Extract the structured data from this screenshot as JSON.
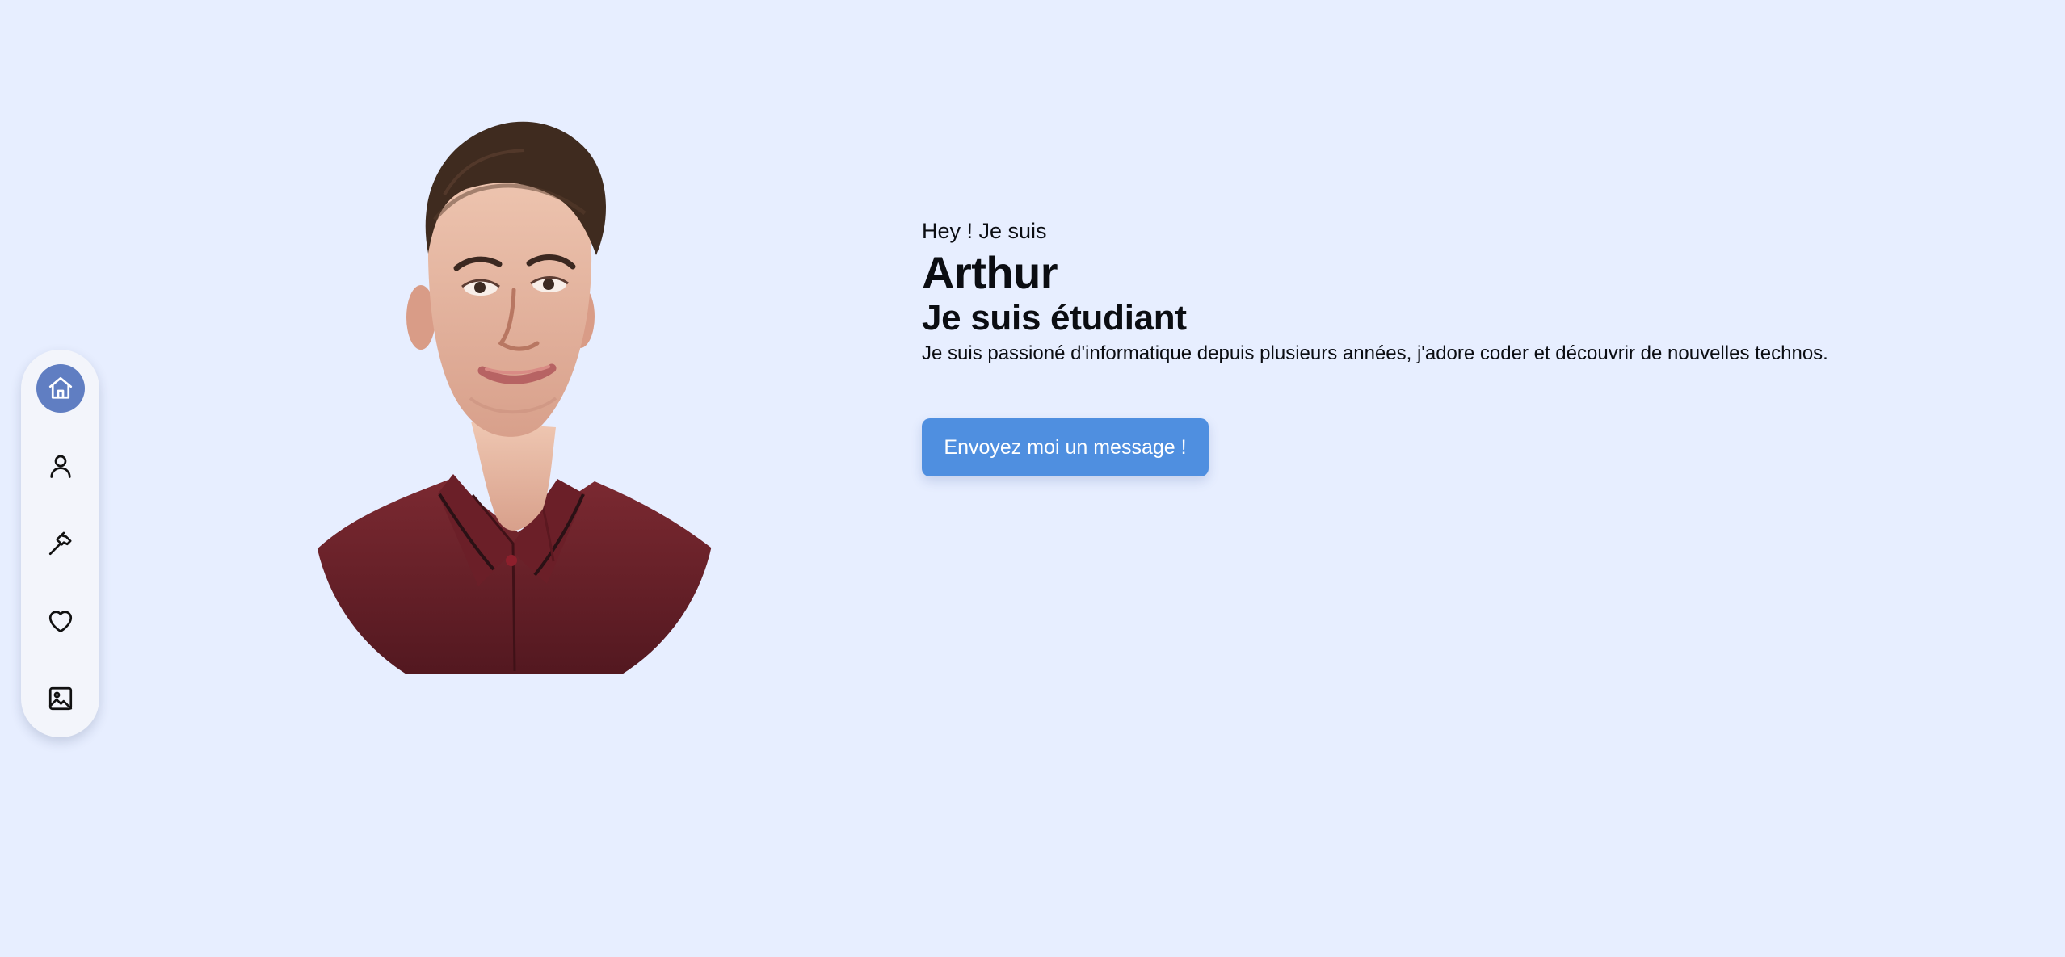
{
  "navigation": {
    "items": [
      {
        "name": "home",
        "icon": "home-icon",
        "active": true
      },
      {
        "name": "profile",
        "icon": "user-icon",
        "active": false
      },
      {
        "name": "projects",
        "icon": "hammer-icon",
        "active": false
      },
      {
        "name": "interests",
        "icon": "heart-icon",
        "active": false
      },
      {
        "name": "gallery",
        "icon": "image-icon",
        "active": false
      }
    ]
  },
  "hero": {
    "greeting": "Hey ! Je suis",
    "name": "Arthur",
    "role": "Je suis étudiant",
    "bio": "Je suis passioné d'informatique depuis plusieurs années, j'adore coder et découvrir de nouvelles technos.",
    "button_label": "Envoyez moi un message !"
  },
  "colors": {
    "page_background": "#e7eeff",
    "nav_background": "#f3f5fb",
    "active_nav": "#607ec2",
    "button": "#4f8fe0",
    "shirt": "#6e2129"
  }
}
